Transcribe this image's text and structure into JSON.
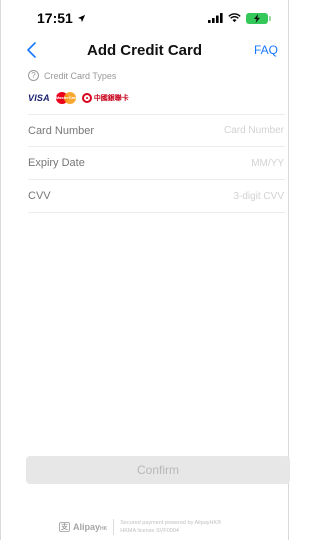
{
  "status_bar": {
    "time": "17:51"
  },
  "nav": {
    "title": "Add Credit Card",
    "faq_label": "FAQ"
  },
  "card_types": {
    "info_glyph": "?",
    "label": "Credit Card Types",
    "visa": "VISA",
    "mastercard": "MasterCard",
    "unionpay": "中國銀聯卡"
  },
  "form": {
    "card_number": {
      "label": "Card Number",
      "placeholder": "Card Number",
      "value": ""
    },
    "expiry_date": {
      "label": "Expiry Date",
      "placeholder": "MM/YY",
      "value": ""
    },
    "cvv": {
      "label": "CVV",
      "placeholder": "3-digit CVV",
      "value": ""
    }
  },
  "confirm_label": "Confirm",
  "footer": {
    "brand_icon": "支",
    "brand_name": "Alipay",
    "brand_suffix": "HK",
    "powered_by_line1": "Secured payment powered by AlipayHK®",
    "powered_by_line2": "HKMA license SVF0004"
  },
  "colors": {
    "accent": "#1677ff",
    "battery": "#34c759",
    "confirm_disabled_bg": "#e7e7e7",
    "confirm_disabled_text": "#b8b8b8"
  },
  "icons": {
    "location": "location-arrow-icon",
    "signal": "signal-icon",
    "wifi": "wifi-icon",
    "battery": "battery-charging-icon",
    "back": "chevron-left-icon",
    "info": "question-circle-icon"
  }
}
